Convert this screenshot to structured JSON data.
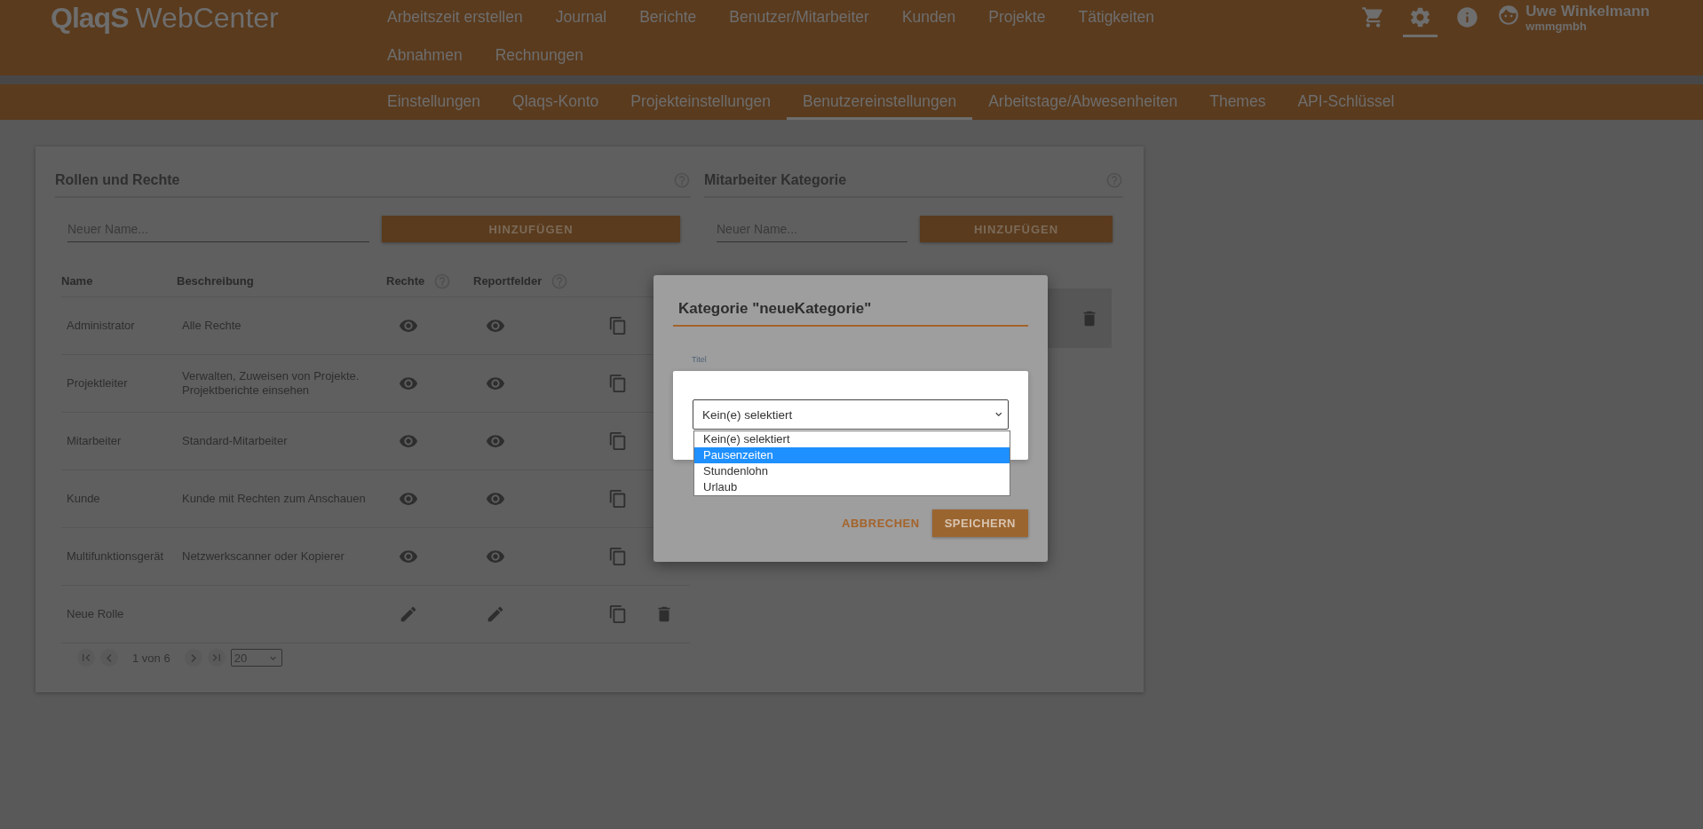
{
  "header": {
    "logo": "QlaqS",
    "product": "WebCenter",
    "nav": [
      "Arbeitszeit erstellen",
      "Journal",
      "Berichte",
      "Benutzer/Mitarbeiter",
      "Kunden",
      "Projekte",
      "Tätigkeiten",
      "Abnahmen",
      "Rechnungen"
    ],
    "icons": [
      {
        "kind": "cart",
        "selected": false
      },
      {
        "kind": "settings",
        "selected": true
      },
      {
        "kind": "info",
        "selected": false
      }
    ],
    "user": {
      "name": "Uwe Winkelmann",
      "company": "wmmgmbh"
    }
  },
  "subnav": [
    {
      "label": "Einstellungen",
      "selected": false
    },
    {
      "label": "Qlaqs-Konto",
      "selected": false
    },
    {
      "label": "Projekteinstellungen",
      "selected": false
    },
    {
      "label": "Benutzereinstellungen",
      "selected": true
    },
    {
      "label": "Arbeitstage/Abwesenheiten",
      "selected": false
    },
    {
      "label": "Themes",
      "selected": false
    },
    {
      "label": "API-Schlüssel",
      "selected": false
    }
  ],
  "roles": {
    "title": "Rollen und Rechte",
    "name_placeholder": "Neuer Name...",
    "add_button": "HINZUFÜGEN",
    "columns": [
      {
        "label": "Name",
        "help": false
      },
      {
        "label": "Beschreibung",
        "help": false
      },
      {
        "label": "Rechte",
        "help": true
      },
      {
        "label": "Reportfelder",
        "help": true
      }
    ],
    "rows": [
      {
        "name": "Administrator",
        "description": "Alle Rechte",
        "kind": "view",
        "deletable": false
      },
      {
        "name": "Projektleiter",
        "description": "Verwalten, Zuweisen von Projekte. Projektberichte einsehen",
        "kind": "view",
        "deletable": false
      },
      {
        "name": "Mitarbeiter",
        "description": "Standard-Mitarbeiter",
        "kind": "view",
        "deletable": false
      },
      {
        "name": "Kunde",
        "description": "Kunde mit Rechten zum Anschauen",
        "kind": "view",
        "deletable": false
      },
      {
        "name": "Multifunktionsgerät",
        "description": "Netzwerkscanner oder Kopierer",
        "kind": "view",
        "deletable": false
      },
      {
        "name": "Neue Rolle",
        "description": "",
        "kind": "edit",
        "deletable": true
      }
    ],
    "pagination": {
      "page": "1 von 6",
      "page_size": "20"
    }
  },
  "categories": {
    "title": "Mitarbeiter Kategorie",
    "name_placeholder": "Neuer Name...",
    "add_button": "HINZUFÜGEN"
  },
  "dialog": {
    "title": "Kategorie \"neueKategorie\"",
    "field_label": "Titel",
    "select_value": "Kein(e) selektiert",
    "options": [
      {
        "label": "Kein(e) selektiert",
        "selected": false
      },
      {
        "label": "Pausenzeiten",
        "selected": true
      },
      {
        "label": "Stundenlohn",
        "selected": false
      },
      {
        "label": "Urlaub",
        "selected": false
      }
    ],
    "cancel": "ABBRECHEN",
    "save": "SPEICHERN"
  }
}
